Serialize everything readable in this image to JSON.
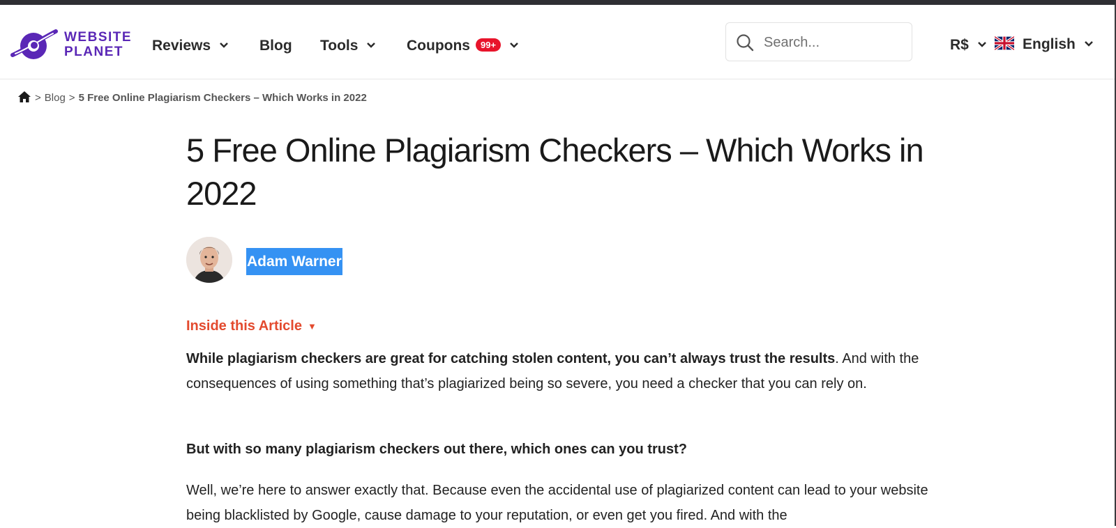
{
  "header": {
    "logo_line1": "WEBSITE",
    "logo_line2": "PLANET",
    "nav": {
      "reviews": "Reviews",
      "blog": "Blog",
      "tools": "Tools",
      "coupons": "Coupons",
      "coupons_badge": "99+"
    },
    "search_placeholder": "Search...",
    "currency": "R$",
    "language": "English",
    "brand_color": "#5a27b6",
    "badge_color": "#e8142b"
  },
  "breadcrumb": {
    "sep1": ">",
    "blog": "Blog",
    "sep2": ">",
    "current": "5 Free Online Plagiarism Checkers – Which Works in 2022"
  },
  "article": {
    "title": "5 Free Online Plagiarism Checkers – Which Works in 2022",
    "author": "Adam Warner",
    "toc_label": "Inside this Article",
    "toc_icon": "▼",
    "p1_bold": "While plagiarism checkers are great for catching stolen content, you can’t always trust the results",
    "p1_rest": ". And with the consequences of using something that’s plagiarized being so severe, you need a checker that you can rely on.",
    "p2": "But with so many plagiarism checkers out there, which ones can you trust?",
    "p3": "Well, we’re here to answer exactly that. Because even the accidental use of plagiarized content can lead to your website being blacklisted by Google, cause damage to your reputation, or even get you fired. And with the",
    "toc_color": "#e34a2e",
    "highlight_color": "#3592f3"
  }
}
